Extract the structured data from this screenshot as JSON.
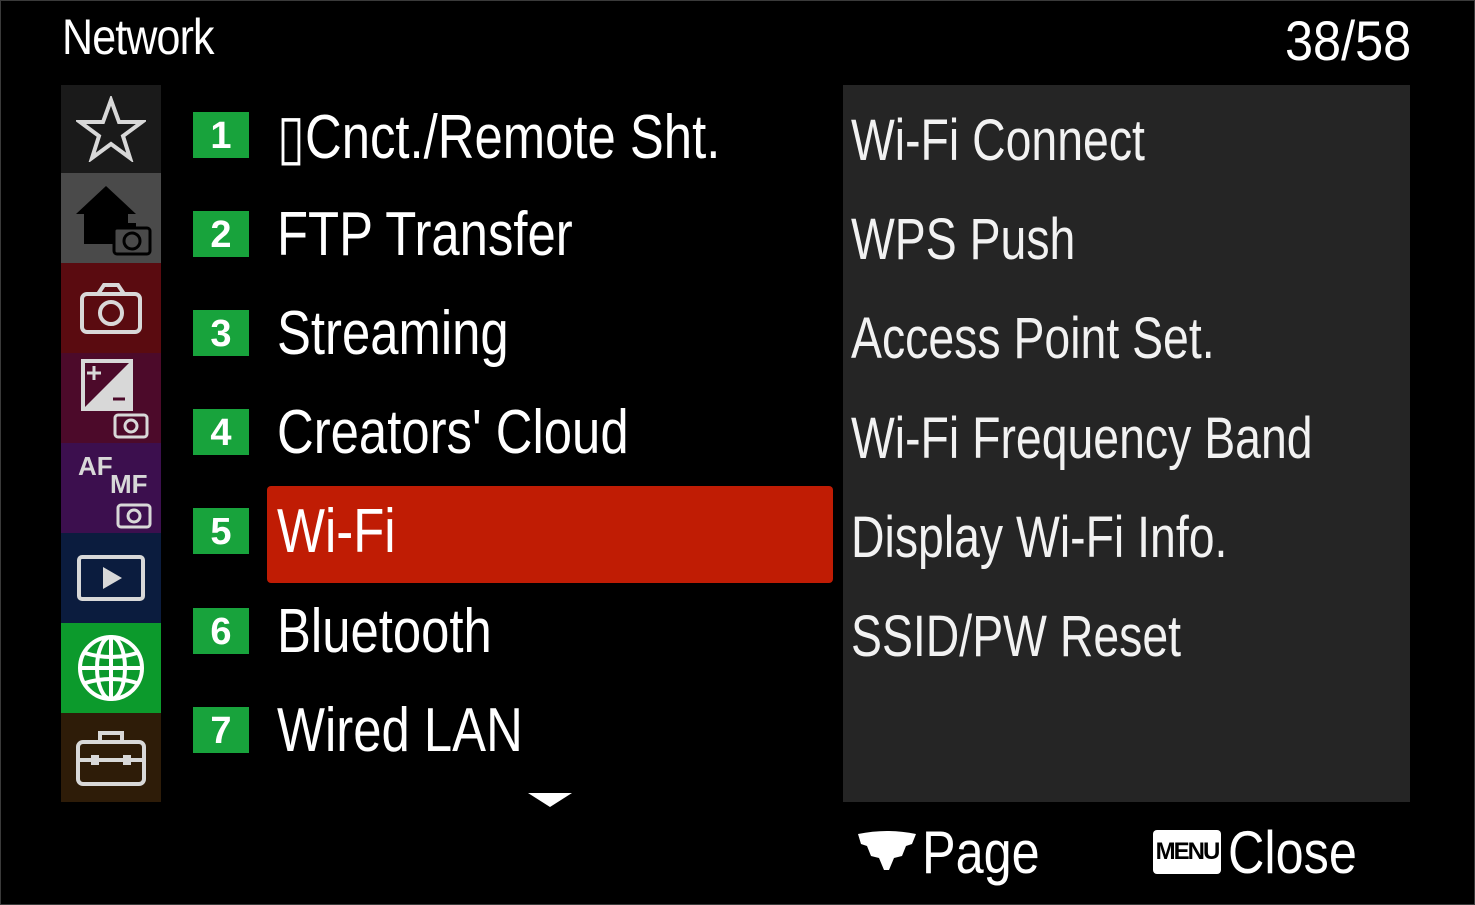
{
  "header": {
    "title": "Network",
    "page_counter": "38/58"
  },
  "categories": [
    {
      "name": "My Menu",
      "icon": "star-icon",
      "color": "#1a1a1a"
    },
    {
      "name": "Main",
      "icon": "home-camera-icon",
      "color": "#4a4a4a"
    },
    {
      "name": "Shooting",
      "icon": "camera-icon",
      "color": "#5a0b10"
    },
    {
      "name": "Exposure/Color",
      "icon": "exposure-icon",
      "color": "#4c0a2a"
    },
    {
      "name": "Focus",
      "icon": "af-mf-icon",
      "icon_text_af": "AF",
      "icon_text_mf": "MF",
      "color": "#3c0f4e"
    },
    {
      "name": "Playback",
      "icon": "playback-icon",
      "color": "#0b1c3e"
    },
    {
      "name": "Network",
      "icon": "globe-icon",
      "color": "#0c9a2c"
    },
    {
      "name": "Setup",
      "icon": "toolbox-icon",
      "color": "#2e1c08"
    }
  ],
  "menu_items": [
    {
      "number": "1",
      "label": "▯Cnct./Remote Sht."
    },
    {
      "number": "2",
      "label": "FTP Transfer"
    },
    {
      "number": "3",
      "label": "Streaming"
    },
    {
      "number": "4",
      "label": "Creators' Cloud"
    },
    {
      "number": "5",
      "label": "Wi-Fi",
      "selected": true
    },
    {
      "number": "6",
      "label": "Bluetooth"
    },
    {
      "number": "7",
      "label": "Wired LAN"
    }
  ],
  "submenu": [
    "Wi-Fi Connect",
    "WPS Push",
    "Access Point Set.",
    "Wi-Fi Frequency Band",
    "Display Wi-Fi Info.",
    "SSID/PW Reset"
  ],
  "footer": {
    "page_label": "Page",
    "menu_key": "MENU",
    "close_label": "Close"
  },
  "colors": {
    "selection": "#c01c04",
    "number_badge": "#18a33c",
    "panel": "#252525"
  }
}
